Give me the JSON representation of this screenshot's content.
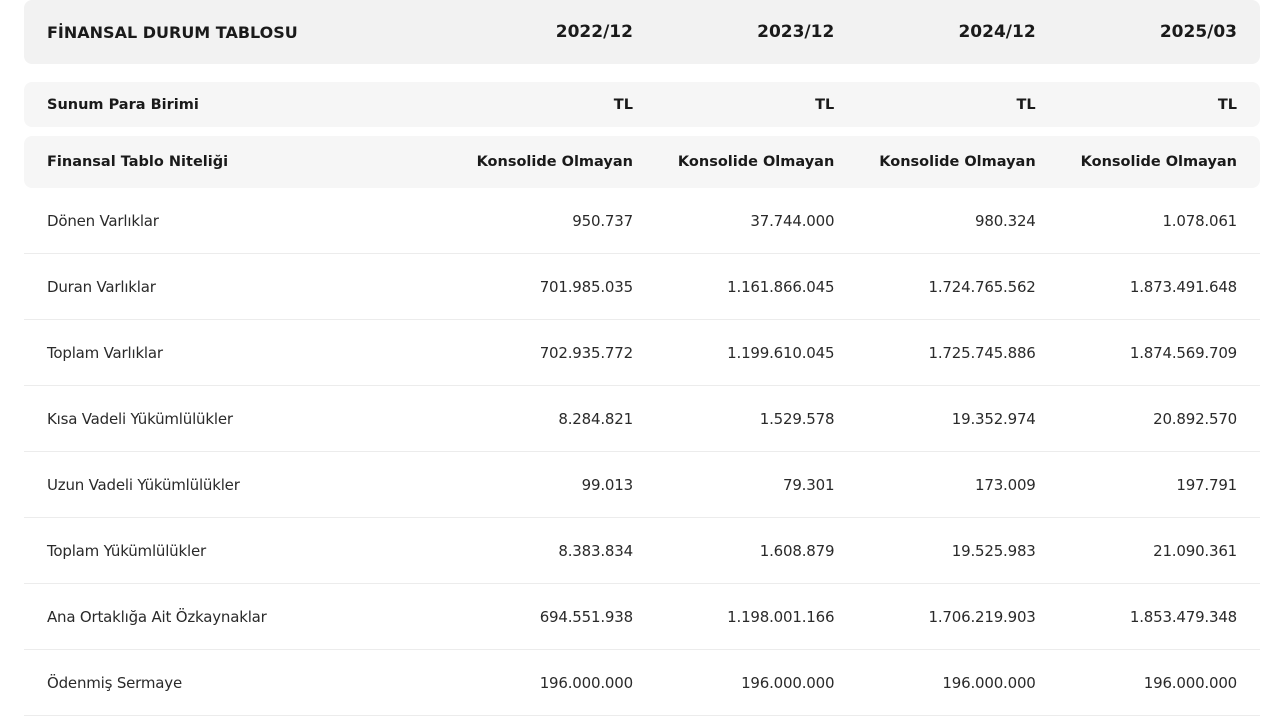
{
  "header": {
    "title": "FİNANSAL DURUM TABLOSU",
    "periods": [
      "2022/12",
      "2023/12",
      "2024/12",
      "2025/03"
    ]
  },
  "currency": {
    "label": "Sunum Para Birimi",
    "values": [
      "TL",
      "TL",
      "TL",
      "TL"
    ]
  },
  "nature": {
    "label": "Finansal Tablo Niteliği",
    "values": [
      "Konsolide Olmayan",
      "Konsolide Olmayan",
      "Konsolide Olmayan",
      "Konsolide Olmayan"
    ]
  },
  "rows": [
    {
      "label": "Dönen Varlıklar",
      "values": [
        "950.737",
        "37.744.000",
        "980.324",
        "1.078.061"
      ]
    },
    {
      "label": "Duran Varlıklar",
      "values": [
        "701.985.035",
        "1.161.866.045",
        "1.724.765.562",
        "1.873.491.648"
      ]
    },
    {
      "label": "Toplam Varlıklar",
      "values": [
        "702.935.772",
        "1.199.610.045",
        "1.725.745.886",
        "1.874.569.709"
      ]
    },
    {
      "label": "Kısa Vadeli Yükümlülükler",
      "values": [
        "8.284.821",
        "1.529.578",
        "19.352.974",
        "20.892.570"
      ]
    },
    {
      "label": "Uzun Vadeli Yükümlülükler",
      "values": [
        "99.013",
        "79.301",
        "173.009",
        "197.791"
      ]
    },
    {
      "label": "Toplam Yükümlülükler",
      "values": [
        "8.383.834",
        "1.608.879",
        "19.525.983",
        "21.090.361"
      ]
    },
    {
      "label": "Ana Ortaklığa Ait Özkaynaklar",
      "values": [
        "694.551.938",
        "1.198.001.166",
        "1.706.219.903",
        "1.853.479.348"
      ]
    },
    {
      "label": "Ödenmiş Sermaye",
      "values": [
        "196.000.000",
        "196.000.000",
        "196.000.000",
        "196.000.000"
      ]
    }
  ]
}
